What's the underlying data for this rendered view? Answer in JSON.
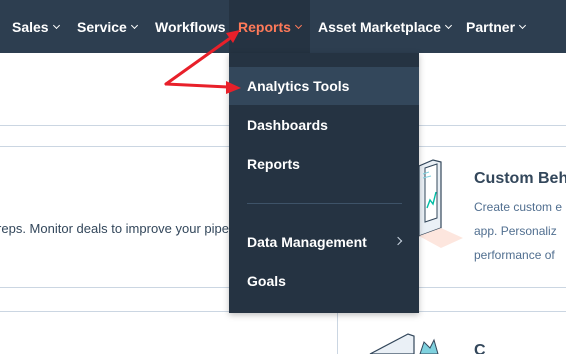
{
  "nav": {
    "items": [
      {
        "label": "Sales"
      },
      {
        "label": "Service"
      },
      {
        "label": "Workflows"
      },
      {
        "label": "Reports"
      },
      {
        "label": "Asset Marketplace"
      },
      {
        "label": "Partner"
      }
    ]
  },
  "dropdown": {
    "items": [
      {
        "label": "Analytics Tools"
      },
      {
        "label": "Dashboards"
      },
      {
        "label": "Reports"
      },
      {
        "label": "Data Management"
      },
      {
        "label": "Goals"
      }
    ]
  },
  "content": {
    "left_text": "reps. Monitor deals to improve your pipe",
    "card_title": "Custom Beh",
    "card_lines": [
      "Create custom e",
      "app. Personaliz",
      "performance of"
    ],
    "card_title_2": "C"
  },
  "colors": {
    "nav_bg": "#2d3e50",
    "dropdown_bg": "#253342",
    "accent": "#ff7a59",
    "annotation_arrow": "#e8202a"
  }
}
